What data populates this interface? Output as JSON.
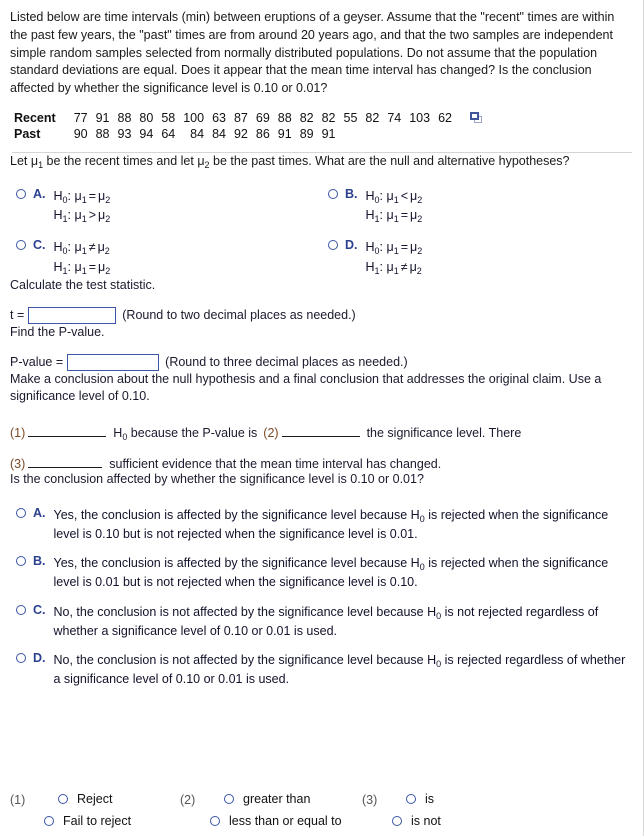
{
  "problem": {
    "intro": "Listed below are time intervals (min) between eruptions of a geyser. Assume that the \"recent\" times are within the past few years, the \"past\" times are from around 20 years ago, and that the two samples are independent simple random samples selected from normally distributed populations. Do not assume that the population standard deviations are equal. Does it appear that the mean time interval has changed? Is the conclusion affected by whether the significance level is 0.10 or 0.01?"
  },
  "data_table": {
    "rows": [
      {
        "label": "Recent",
        "values": [
          "77",
          "91",
          "88",
          "80",
          "58",
          "100",
          "63",
          "87",
          "69",
          "88",
          "82",
          "82",
          "55",
          "82",
          "74",
          "103",
          "62"
        ]
      },
      {
        "label": "Past",
        "values": [
          "90",
          "88",
          "93",
          "94",
          "64",
          "84",
          "84",
          "92",
          "86",
          "91",
          "89",
          "91"
        ]
      }
    ],
    "copy_icon": "copy-to-clipboard-icon"
  },
  "hypotheses": {
    "prompt_a": "Let μ",
    "prompt_sub1": "1",
    "prompt_b": " be the recent times and let μ",
    "prompt_sub2": "2",
    "prompt_c": " be the past times. What are the null and alternative hypotheses?",
    "options": [
      {
        "letter": "A.",
        "null_symbol": "H",
        "null_sub": "0",
        "null_left": "μ",
        "null_left_sub": "1",
        "null_op": "=",
        "null_right": "μ",
        "null_right_sub": "2",
        "alt_symbol": "H",
        "alt_sub": "1",
        "alt_left": "μ",
        "alt_left_sub": "1",
        "alt_op": ">",
        "alt_right": "μ",
        "alt_right_sub": "2"
      },
      {
        "letter": "B.",
        "null_symbol": "H",
        "null_sub": "0",
        "null_left": "μ",
        "null_left_sub": "1",
        "null_op": "<",
        "null_right": "μ",
        "null_right_sub": "2",
        "alt_symbol": "H",
        "alt_sub": "1",
        "alt_left": "μ",
        "alt_left_sub": "1",
        "alt_op": "=",
        "alt_right": "μ",
        "alt_right_sub": "2"
      },
      {
        "letter": "C.",
        "null_symbol": "H",
        "null_sub": "0",
        "null_left": "μ",
        "null_left_sub": "1",
        "null_op": "≠",
        "null_right": "μ",
        "null_right_sub": "2",
        "alt_symbol": "H",
        "alt_sub": "1",
        "alt_left": "μ",
        "alt_left_sub": "1",
        "alt_op": "=",
        "alt_right": "μ",
        "alt_right_sub": "2"
      },
      {
        "letter": "D.",
        "null_symbol": "H",
        "null_sub": "0",
        "null_left": "μ",
        "null_left_sub": "1",
        "null_op": "=",
        "null_right": "μ",
        "null_right_sub": "2",
        "alt_symbol": "H",
        "alt_sub": "1",
        "alt_left": "μ",
        "alt_left_sub": "1",
        "alt_op": "≠",
        "alt_right": "μ",
        "alt_right_sub": "2"
      }
    ]
  },
  "test_statistic": {
    "prompt": "Calculate the test statistic.",
    "label": "t =",
    "value": "",
    "hint": "(Round to two decimal places as needed.)"
  },
  "p_value": {
    "prompt": "Find the P-value.",
    "label": "P-value =",
    "value": "",
    "hint": "(Round to three decimal places as needed.)"
  },
  "conclusion": {
    "intro": "Make a conclusion about the null hypothesis and a final conclusion that addresses the original claim. Use a significance level of 0.10.",
    "line1_num": "(1)",
    "line1_mid_a": "H",
    "line1_mid_sub": "0",
    "line1_mid_b": " because the P-value is",
    "line1_num2": "(2)",
    "line1_tail": "the significance level. There",
    "line2_num": "(3)",
    "line2_tail": "sufficient evidence that the mean time interval has changed."
  },
  "final_question": {
    "prompt": "Is the conclusion affected by whether the significance level is 0.10 or 0.01?",
    "options": [
      {
        "letter": "A.",
        "text_before": "Yes, the conclusion is affected by the significance level because H",
        "sub": "0",
        "text_after": " is rejected when the significance level is 0.10 but is not rejected when the significance level is 0.01."
      },
      {
        "letter": "B.",
        "text_before": "Yes, the conclusion is affected by the significance level because H",
        "sub": "0",
        "text_after": " is rejected when the significance level is 0.01 but is not rejected when the significance level is 0.10."
      },
      {
        "letter": "C.",
        "text_before": "No, the conclusion is not affected by the significance level because H",
        "sub": "0",
        "text_after": " is not rejected regardless of whether a significance level of 0.10 or 0.01 is used."
      },
      {
        "letter": "D.",
        "text_before": "No, the conclusion is not affected by the significance level because H",
        "sub": "0",
        "text_after": " is rejected regardless of whether a significance level of 0.10 or 0.01 is used."
      }
    ]
  },
  "answer_bank": {
    "groups": [
      {
        "num": "(1)",
        "options": [
          "Reject",
          "Fail to reject"
        ]
      },
      {
        "num": "(2)",
        "options": [
          "greater than",
          "less than or equal to"
        ]
      },
      {
        "num": "(3)",
        "options": [
          "is",
          "is not"
        ]
      }
    ]
  },
  "colors": {
    "accent_blue": "#3b55a8",
    "letter_blue": "#2b3f8f",
    "blank_num": "#7b4a27",
    "divider": "#d5d5d5"
  }
}
